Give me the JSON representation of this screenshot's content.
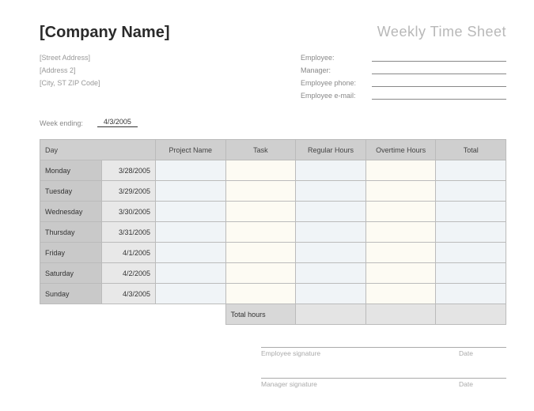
{
  "header": {
    "company": "[Company Name]",
    "title": "Weekly Time Sheet"
  },
  "address": {
    "line1": "[Street Address]",
    "line2": "[Address 2]",
    "line3": "[City, ST  ZIP Code]"
  },
  "employee_fields": {
    "employee_label": "Employee:",
    "manager_label": "Manager:",
    "phone_label": "Employee phone:",
    "email_label": "Employee e-mail:",
    "employee_value": "",
    "manager_value": "",
    "phone_value": "",
    "email_value": ""
  },
  "week": {
    "label": "Week ending:",
    "value": "4/3/2005"
  },
  "columns": {
    "day": "Day",
    "project": "Project Name",
    "task": "Task",
    "regular": "Regular Hours",
    "overtime": "Overtime Hours",
    "total": "Total"
  },
  "rows": [
    {
      "day": "Monday",
      "date": "3/28/2005",
      "project": "",
      "task": "",
      "regular": "",
      "overtime": "",
      "total": ""
    },
    {
      "day": "Tuesday",
      "date": "3/29/2005",
      "project": "",
      "task": "",
      "regular": "",
      "overtime": "",
      "total": ""
    },
    {
      "day": "Wednesday",
      "date": "3/30/2005",
      "project": "",
      "task": "",
      "regular": "",
      "overtime": "",
      "total": ""
    },
    {
      "day": "Thursday",
      "date": "3/31/2005",
      "project": "",
      "task": "",
      "regular": "",
      "overtime": "",
      "total": ""
    },
    {
      "day": "Friday",
      "date": "4/1/2005",
      "project": "",
      "task": "",
      "regular": "",
      "overtime": "",
      "total": ""
    },
    {
      "day": "Saturday",
      "date": "4/2/2005",
      "project": "",
      "task": "",
      "regular": "",
      "overtime": "",
      "total": ""
    },
    {
      "day": "Sunday",
      "date": "4/3/2005",
      "project": "",
      "task": "",
      "regular": "",
      "overtime": "",
      "total": ""
    }
  ],
  "totals": {
    "label": "Total hours",
    "regular": "",
    "overtime": "",
    "total": ""
  },
  "signatures": {
    "emp_label": "Employee signature",
    "mgr_label": "Manager signature",
    "date_label": "Date"
  }
}
